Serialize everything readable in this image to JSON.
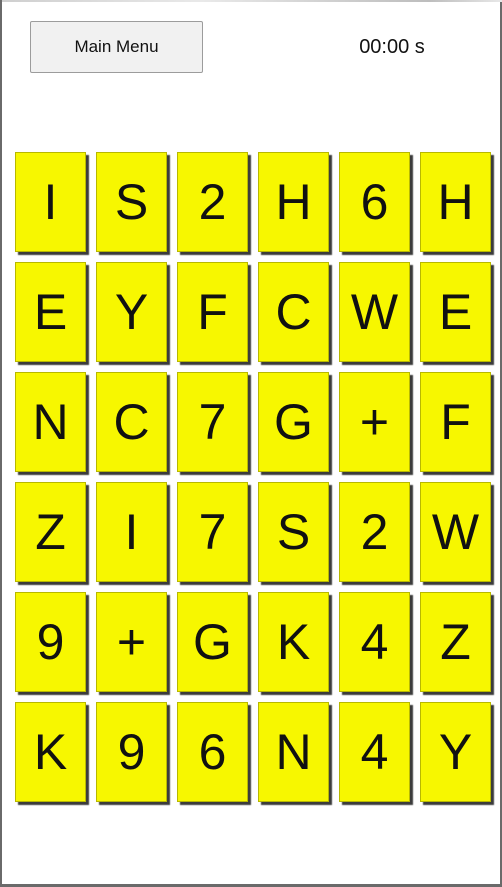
{
  "header": {
    "menu_label": "Main Menu",
    "timer": "00:00 s"
  },
  "board": {
    "tile_color": "#f7f700",
    "rows": [
      [
        "I",
        "S",
        "2",
        "H",
        "6",
        "H"
      ],
      [
        "E",
        "Y",
        "F",
        "C",
        "W",
        "E"
      ],
      [
        "N",
        "C",
        "7",
        "G",
        "+",
        "F"
      ],
      [
        "Z",
        "I",
        "7",
        "S",
        "2",
        "W"
      ],
      [
        "9",
        "+",
        "G",
        "K",
        "4",
        "Z"
      ],
      [
        "K",
        "9",
        "6",
        "N",
        "4",
        "Y"
      ]
    ]
  }
}
